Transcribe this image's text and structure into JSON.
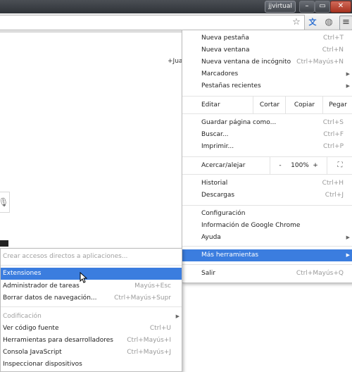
{
  "titlebar": {
    "user": "jjvirtual",
    "min": "–",
    "max": "▭",
    "close": "✕"
  },
  "toolbar": {
    "star_icon": "star-icon",
    "translate_icon": "translate-icon",
    "extension_icon": "extension-icon",
    "menu_icon": "menu-icon"
  },
  "page": {
    "link_text": "+Jua"
  },
  "main_menu": {
    "new_tab": {
      "label": "Nueva pestaña",
      "shortcut": "Ctrl+T"
    },
    "new_window": {
      "label": "Nueva ventana",
      "shortcut": "Ctrl+N"
    },
    "incognito": {
      "label": "Nueva ventana de incógnito",
      "shortcut": "Ctrl+Mayús+N"
    },
    "bookmarks": {
      "label": "Marcadores"
    },
    "recent_tabs": {
      "label": "Pestañas recientes"
    },
    "edit": {
      "label": "Editar",
      "cut": "Cortar",
      "copy": "Copiar",
      "paste": "Pegar"
    },
    "save_page": {
      "label": "Guardar página como...",
      "shortcut": "Ctrl+S"
    },
    "find": {
      "label": "Buscar...",
      "shortcut": "Ctrl+F"
    },
    "print": {
      "label": "Imprimir...",
      "shortcut": "Ctrl+P"
    },
    "zoom": {
      "label": "Acercar/alejar",
      "minus": "-",
      "value": "100%",
      "plus": "+"
    },
    "history": {
      "label": "Historial",
      "shortcut": "Ctrl+H"
    },
    "downloads": {
      "label": "Descargas",
      "shortcut": "Ctrl+J"
    },
    "settings": {
      "label": "Configuración"
    },
    "about": {
      "label": "Información de Google Chrome"
    },
    "help": {
      "label": "Ayuda"
    },
    "more_tools": {
      "label": "Más herramientas"
    },
    "exit": {
      "label": "Salir",
      "shortcut": "Ctrl+Mayús+Q"
    }
  },
  "sub_menu": {
    "app_shortcuts": {
      "label": "Crear accesos directos a aplicaciones..."
    },
    "extensions": {
      "label": "Extensiones"
    },
    "task_manager": {
      "label": "Administrador de tareas",
      "shortcut": "Mayús+Esc"
    },
    "clear_data": {
      "label": "Borrar datos de navegación...",
      "shortcut": "Ctrl+Mayús+Supr"
    },
    "encoding": {
      "label": "Codificación"
    },
    "view_source": {
      "label": "Ver código fuente",
      "shortcut": "Ctrl+U"
    },
    "dev_tools": {
      "label": "Herramientas para desarrolladores",
      "shortcut": "Ctrl+Mayús+I"
    },
    "js_console": {
      "label": "Consola JavaScript",
      "shortcut": "Ctrl+Mayús+J"
    },
    "inspect": {
      "label": "Inspeccionar dispositivos"
    }
  },
  "colors": {
    "highlight": "#3b7ddf"
  }
}
